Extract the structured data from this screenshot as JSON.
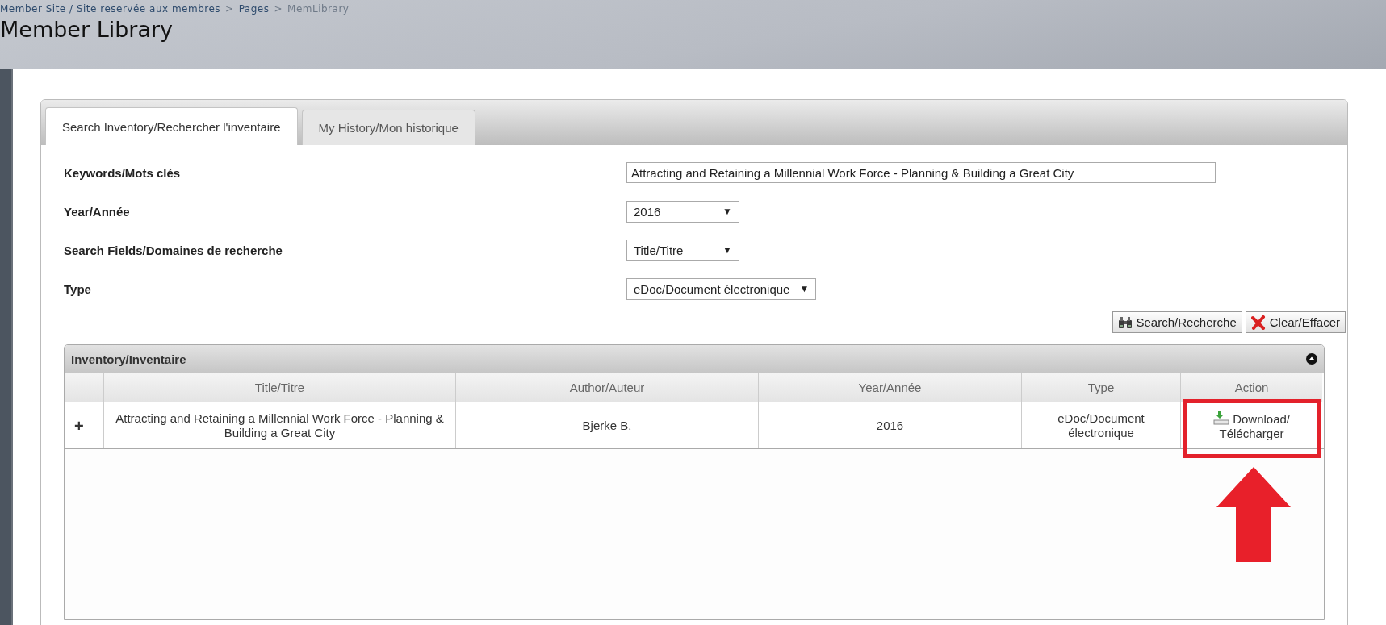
{
  "breadcrumb": [
    {
      "label": "Member Site / Site reservée aux membres",
      "current": false
    },
    {
      "label": "Pages",
      "current": false
    },
    {
      "label": "MemLibrary",
      "current": true
    }
  ],
  "breadcrumb_separator": ">",
  "page_title": "Member Library",
  "tabs": [
    {
      "label": "Search Inventory/Rechercher l'inventaire",
      "selected": true
    },
    {
      "label": "My History/Mon historique",
      "selected": false
    }
  ],
  "form": [
    {
      "label": "Keywords/Mots clés",
      "kind": "text",
      "value": "Attracting and Retaining a Millennial Work Force - Planning & Building a Great City"
    },
    {
      "label": "Year/Année",
      "kind": "select",
      "value": "2016",
      "arrow": "▼"
    },
    {
      "label": "Search Fields/Domaines de recherche",
      "kind": "select",
      "value": "Title/Titre",
      "arrow": "▼"
    },
    {
      "label": "Type",
      "kind": "select",
      "value": "eDoc/Document électronique",
      "arrow": "▼"
    }
  ],
  "buttons": [
    {
      "label": "Search/Recherche",
      "kind": "search"
    },
    {
      "label": "Clear/Effacer",
      "kind": "clear"
    }
  ],
  "inventory": {
    "title": "Inventory/Inventaire",
    "collapsed": false,
    "columns": [
      "Title/Titre",
      "Author/Auteur",
      "Year/Année",
      "Type",
      "Action"
    ],
    "rows": [
      {
        "expand": "+",
        "title": "Attracting and Retaining a Millennial Work Force - Planning & Building a Great City",
        "author": "Bjerke B.",
        "year": "2016",
        "type": "eDoc/Document électronique",
        "action": "Download/ Télécharger",
        "highlighted": true
      }
    ]
  }
}
